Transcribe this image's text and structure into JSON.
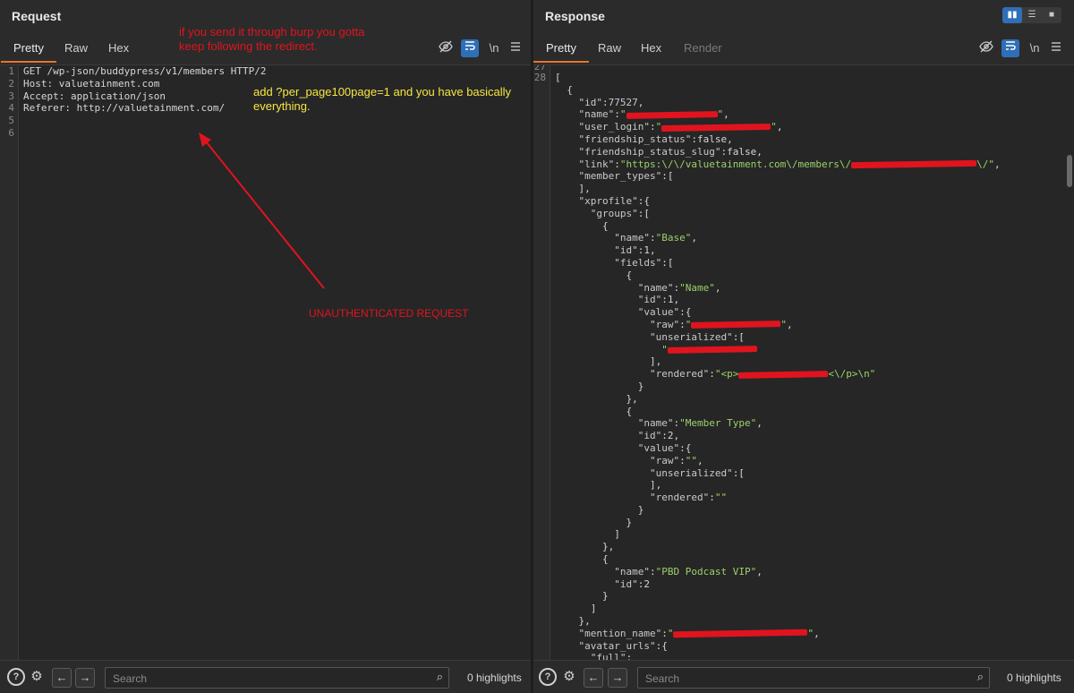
{
  "request": {
    "title": "Request",
    "tabs": [
      "Pretty",
      "Raw",
      "Hex"
    ],
    "active_tab": "Pretty",
    "tool_icons": [
      "eye-off-icon",
      "wrap-icon",
      "newline-icon",
      "menu-icon"
    ],
    "newline_label": "\\n",
    "line_numbers": [
      "1",
      "2",
      "3",
      "4",
      "5",
      "6"
    ],
    "lines": [
      "GET /wp-json/buddypress/v1/members HTTP/2",
      "Host: valuetainment.com",
      "Accept: application/json",
      "Referer: http://valuetainment.com/",
      "",
      ""
    ]
  },
  "annotations": {
    "burp_note_line1": "if you send it through burp you gotta",
    "burp_note_line2": "keep following the redirect.",
    "param_note_line1": "add ?per_page100page=1 and you have basically",
    "param_note_line2": "everything.",
    "unauth_label": "UNAUTHENTICATED REQUEST",
    "red": "#e0141e",
    "yellow": "#f5e642"
  },
  "response": {
    "title": "Response",
    "tabs": [
      "Pretty",
      "Raw",
      "Hex",
      "Render"
    ],
    "active_tab": "Pretty",
    "newline_label": "\\n",
    "line_numbers": [
      "27",
      "28"
    ],
    "layout_icons": [
      "split-vertical-icon",
      "split-horizontal-icon",
      "single-pane-icon"
    ]
  },
  "bottom": {
    "search_placeholder": "Search",
    "highlights": "0 highlights"
  },
  "colors": {
    "accent_tab": "#e8752a",
    "blue_button": "#2f6fb8",
    "json_string": "#9bd16a"
  }
}
